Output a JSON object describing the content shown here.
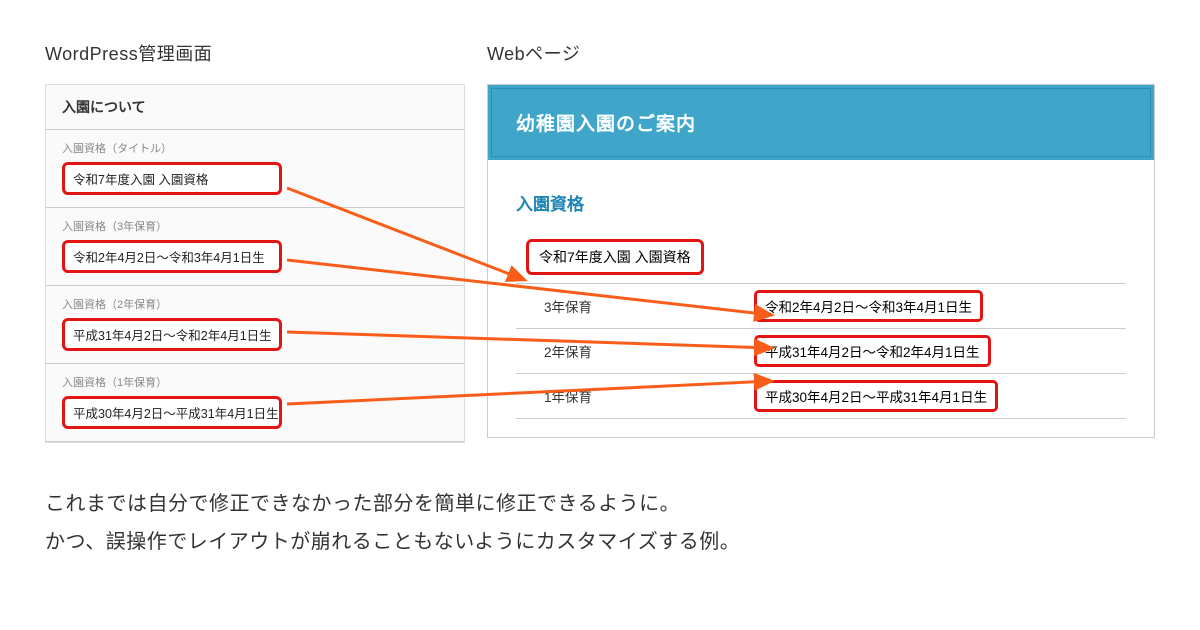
{
  "labels": {
    "admin_label": "WordPress管理画面",
    "web_label": "Webページ"
  },
  "admin": {
    "section_title": "入園について",
    "fields": [
      {
        "label": "入園資格（タイトル）",
        "value": "令和7年度入園 入園資格"
      },
      {
        "label": "入園資格（3年保育）",
        "value": "令和2年4月2日〜令和3年4月1日生"
      },
      {
        "label": "入園資格（2年保育）",
        "value": "平成31年4月2日〜令和2年4月1日生"
      },
      {
        "label": "入園資格（1年保育）",
        "value": "平成30年4月2日〜平成31年4月1日生"
      }
    ]
  },
  "web": {
    "header_title": "幼稚園入園のご案内",
    "section_heading": "入園資格",
    "title_row": "令和7年度入園 入園資格",
    "rows": [
      {
        "label": "3年保育",
        "value": "令和2年4月2日〜令和3年4月1日生"
      },
      {
        "label": "2年保育",
        "value": "平成31年4月2日〜令和2年4月1日生"
      },
      {
        "label": "1年保育",
        "value": "平成30年4月2日〜平成31年4月1日生"
      }
    ]
  },
  "caption": {
    "line1": "これまでは自分で修正できなかった部分を簡単に修正できるように。",
    "line2": "かつ、誤操作でレイアウトが崩れることもないようにカスタマイズする例。"
  },
  "colors": {
    "highlight_border": "#e31414",
    "arrow": "#f85e1a",
    "web_header_bg": "#3fa6c9",
    "web_heading": "#1e86b5"
  }
}
